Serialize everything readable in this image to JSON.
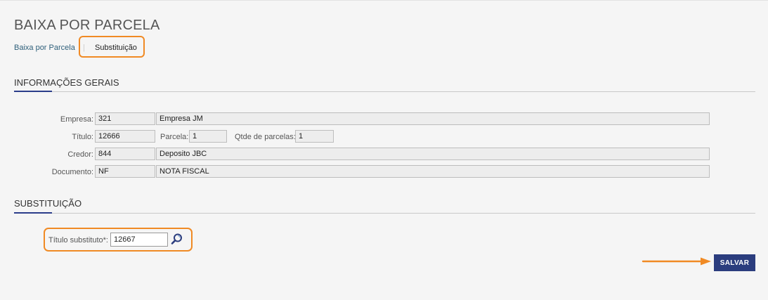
{
  "page": {
    "title": "BAIXA POR PARCELA"
  },
  "breadcrumb": {
    "link": "Baixa por Parcela",
    "separator": "|",
    "current": "Substituição"
  },
  "general": {
    "title": "INFORMAÇÕES GERAIS",
    "empresa": {
      "label": "Empresa:",
      "code": "321",
      "name": "Empresa JM"
    },
    "titulo": {
      "label": "Título:",
      "value": "12666"
    },
    "parcela": {
      "label": "Parcela:",
      "value": "1"
    },
    "qtde": {
      "label": "Qtde de parcelas:",
      "value": "1"
    },
    "credor": {
      "label": "Credor:",
      "code": "844",
      "name": "Deposito JBC"
    },
    "documento": {
      "label": "Documento:",
      "code": "NF",
      "name": "NOTA FISCAL"
    }
  },
  "substitution": {
    "title": "SUBSTITUIÇÃO",
    "titulo_substituto": {
      "label": "Título substituto*:",
      "value": "12667"
    }
  },
  "actions": {
    "save_label": "SALVAR"
  },
  "colors": {
    "accent": "#2b3d7e",
    "highlight": "#f08a24"
  },
  "icons": {
    "lookup": "search-icon"
  }
}
